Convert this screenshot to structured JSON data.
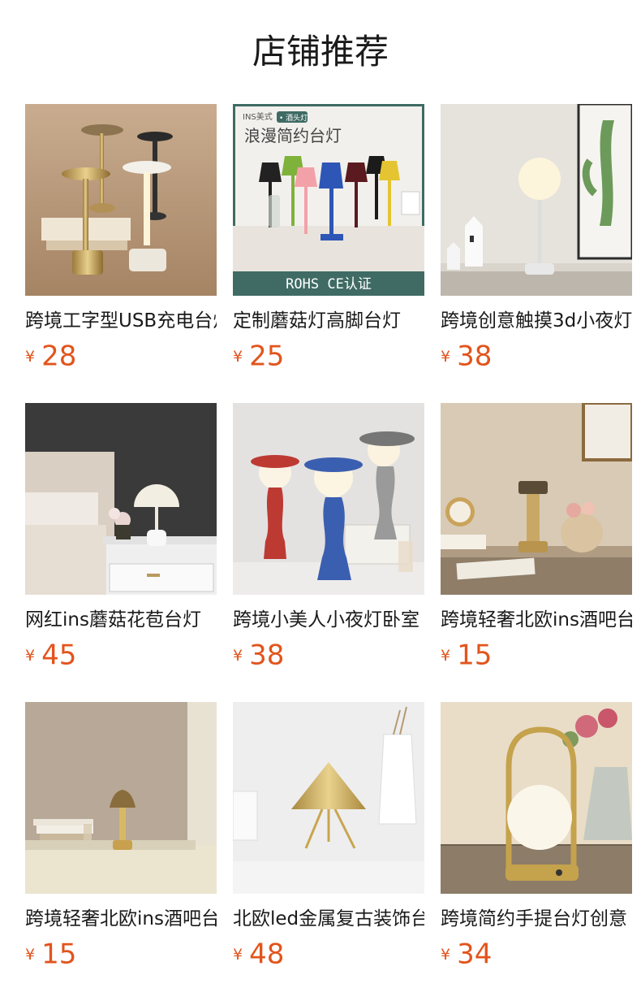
{
  "page": {
    "title": "店铺推荐"
  },
  "products": [
    {
      "name": "跨境工字型USB充电台灯",
      "currency": "¥",
      "price": "28"
    },
    {
      "name": "定制蘑菇灯高脚台灯",
      "currency": "¥",
      "price": "25",
      "banner": {
        "tag": "INS美式",
        "badge": "• 酒头灯",
        "headline": "浪漫简约台灯",
        "footer": "ROHS  CE认证"
      }
    },
    {
      "name": "跨境创意触摸3d小夜灯",
      "currency": "¥",
      "price": "38"
    },
    {
      "name": "网红ins蘑菇花苞台灯",
      "currency": "¥",
      "price": "45"
    },
    {
      "name": "跨境小美人小夜灯卧室",
      "currency": "¥",
      "price": "38"
    },
    {
      "name": "跨境轻奢北欧ins酒吧台灯",
      "currency": "¥",
      "price": "15"
    },
    {
      "name": "跨境轻奢北欧ins酒吧台灯",
      "currency": "¥",
      "price": "15"
    },
    {
      "name": "北欧led金属复古装饰台灯",
      "currency": "¥",
      "price": "48"
    },
    {
      "name": "跨境简约手提台灯创意",
      "currency": "¥",
      "price": "34"
    }
  ],
  "colors": {
    "price": "#e2541c",
    "title": "#1a1a1a"
  }
}
